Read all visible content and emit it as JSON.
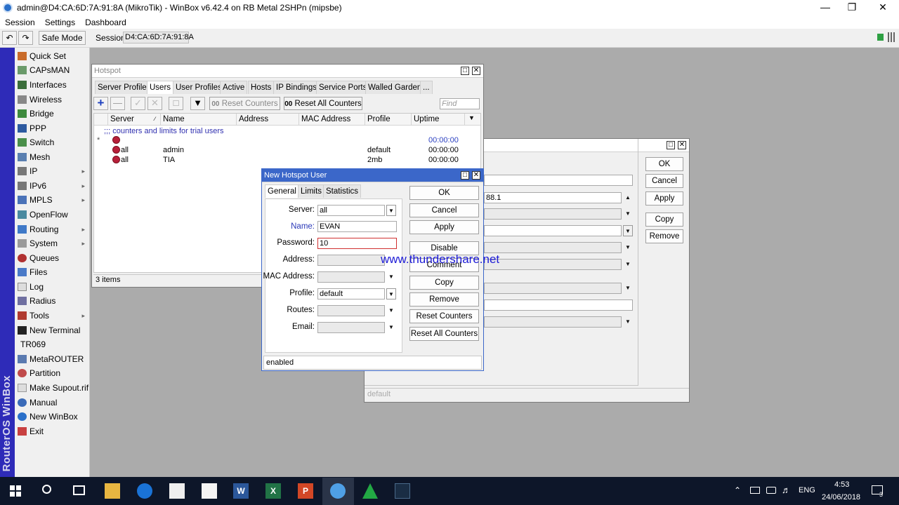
{
  "window": {
    "title": "admin@D4:CA:6D:7A:91:8A (MikroTik) - WinBox v6.42.4 on RB Metal 2SHPn (mipsbe)"
  },
  "menu": [
    "Session",
    "Settings",
    "Dashboard"
  ],
  "toolbar": {
    "safe_mode": "Safe Mode",
    "session_label": "Session:",
    "session_value": "D4:CA:6D:7A:91:8A"
  },
  "brand_vertical": "RouterOS WinBox",
  "sidebar": [
    {
      "label": "Quick Set",
      "submenu": false
    },
    {
      "label": "CAPsMAN",
      "submenu": false
    },
    {
      "label": "Interfaces",
      "submenu": false
    },
    {
      "label": "Wireless",
      "submenu": false
    },
    {
      "label": "Bridge",
      "submenu": false
    },
    {
      "label": "PPP",
      "submenu": false
    },
    {
      "label": "Switch",
      "submenu": false
    },
    {
      "label": "Mesh",
      "submenu": false
    },
    {
      "label": "IP",
      "submenu": true
    },
    {
      "label": "IPv6",
      "submenu": true
    },
    {
      "label": "MPLS",
      "submenu": true
    },
    {
      "label": "OpenFlow",
      "submenu": false
    },
    {
      "label": "Routing",
      "submenu": true
    },
    {
      "label": "System",
      "submenu": true
    },
    {
      "label": "Queues",
      "submenu": false
    },
    {
      "label": "Files",
      "submenu": false
    },
    {
      "label": "Log",
      "submenu": false
    },
    {
      "label": "Radius",
      "submenu": false
    },
    {
      "label": "Tools",
      "submenu": true
    },
    {
      "label": "New Terminal",
      "submenu": false
    },
    {
      "label": "TR069",
      "submenu": false
    },
    {
      "label": "MetaROUTER",
      "submenu": false
    },
    {
      "label": "Partition",
      "submenu": false
    },
    {
      "label": "Make Supout.rif",
      "submenu": false
    },
    {
      "label": "Manual",
      "submenu": false
    },
    {
      "label": "New WinBox",
      "submenu": false
    },
    {
      "label": "Exit",
      "submenu": false
    }
  ],
  "hotspot": {
    "title": "Hotspot",
    "tabs": [
      "Server Profiles",
      "Users",
      "User Profiles",
      "Active",
      "Hosts",
      "IP Bindings",
      "Service Ports",
      "Walled Garden",
      "..."
    ],
    "selected_tab": "Users",
    "buttons": {
      "reset_counters": "Reset Counters",
      "reset_all_counters": "Reset All Counters",
      "find_placeholder": "Find"
    },
    "columns": [
      "Server",
      "Name",
      "Address",
      "MAC Address",
      "Profile",
      "Uptime"
    ],
    "comment_row": ";;; counters and limits for trial users",
    "rows": [
      {
        "flag": "*",
        "server": "",
        "name": "",
        "address": "",
        "mac": "",
        "profile": "",
        "uptime": "00:00:00"
      },
      {
        "flag": "",
        "server": "all",
        "name": "admin",
        "address": "",
        "mac": "",
        "profile": "default",
        "uptime": "00:00:00"
      },
      {
        "flag": "",
        "server": "all",
        "name": "TIA",
        "address": "",
        "mac": "",
        "profile": "2mb",
        "uptime": "00:00:00"
      }
    ],
    "status": "3 items"
  },
  "back_dialog": {
    "buttons": [
      "OK",
      "Cancel",
      "Apply",
      "Copy",
      "Remove"
    ],
    "field_fragment": "88.1",
    "status": "default"
  },
  "new_user": {
    "title": "New Hotspot User",
    "tabs": [
      "General",
      "Limits",
      "Statistics"
    ],
    "selected_tab": "General",
    "fields": {
      "server": {
        "label": "Server:",
        "value": "all"
      },
      "name": {
        "label": "Name:",
        "value": "EVAN"
      },
      "password": {
        "label": "Password:",
        "value": "10"
      },
      "address": {
        "label": "Address:",
        "value": ""
      },
      "mac": {
        "label": "MAC Address:",
        "value": ""
      },
      "profile": {
        "label": "Profile:",
        "value": "default"
      },
      "routes": {
        "label": "Routes:",
        "value": ""
      },
      "email": {
        "label": "Email:",
        "value": ""
      }
    },
    "buttons": [
      "OK",
      "Cancel",
      "Apply",
      "Disable",
      "Comment",
      "Copy",
      "Remove",
      "Reset Counters",
      "Reset All Counters"
    ],
    "status": "enabled"
  },
  "watermark": "www.thundershare.net",
  "taskbar": {
    "lang": "ENG",
    "time": "4:53",
    "date": "24/06/2018",
    "notifications": "3"
  },
  "colors": {
    "accent": "#3b67c9",
    "sidebar_brand": "#2e2bb8",
    "taskbar": "#0d1629",
    "workarea": "#ababab"
  }
}
